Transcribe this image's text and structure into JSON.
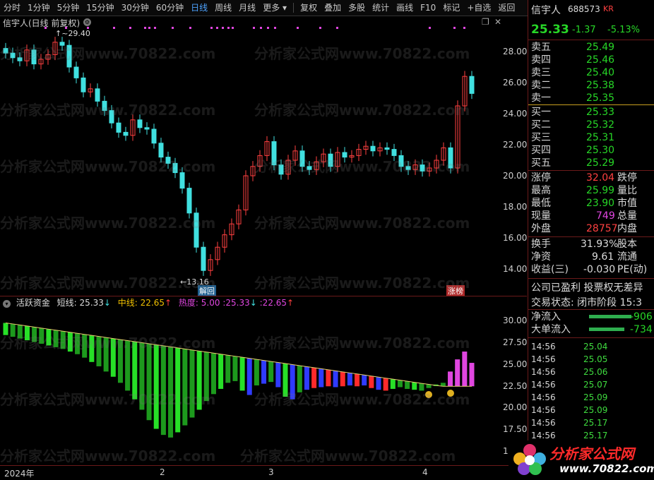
{
  "toolbar": {
    "items": [
      "分时",
      "1分钟",
      "5分钟",
      "15分钟",
      "30分钟",
      "60分钟",
      "日线",
      "周线",
      "月线",
      "更多"
    ],
    "active": "日线",
    "tools": [
      "复权",
      "叠加",
      "多股",
      "统计",
      "画线",
      "F10",
      "标记",
      "+自选",
      "返回"
    ]
  },
  "main_chart": {
    "title": "信宇人(日线 前复权)",
    "high_label": "29.40",
    "low_label": "13.16",
    "badge_left": "解回",
    "badge_right": "涨榜",
    "y_ticks": [
      "28.00",
      "26.00",
      "24.00",
      "22.00",
      "20.00",
      "18.00",
      "16.00",
      "14.00"
    ]
  },
  "indicator": {
    "name": "活跃资金",
    "short_label": "短线:",
    "short_value": "25.33",
    "mid_label": "中线:",
    "mid_value": "22.65",
    "heat_label": "热度:",
    "heat_value": "5.00",
    "extra1": ":25.33",
    "extra2": ":22.65",
    "y_ticks": [
      "30.00",
      "27.50",
      "25.00",
      "22.50",
      "20.00",
      "17.50",
      "15.00"
    ]
  },
  "x_axis": [
    "2024年",
    "2",
    "3",
    "4"
  ],
  "quote": {
    "name": "信宇人",
    "code": "688573",
    "tag": "KR",
    "price": "25.33",
    "change": "-1.37",
    "pct": "-5.13%"
  },
  "order_book": {
    "sells": [
      {
        "label": "卖五",
        "price": "25.49"
      },
      {
        "label": "卖四",
        "price": "25.46"
      },
      {
        "label": "卖三",
        "price": "25.40"
      },
      {
        "label": "卖二",
        "price": "25.38"
      },
      {
        "label": "卖一",
        "price": "25.35"
      }
    ],
    "buys": [
      {
        "label": "买一",
        "price": "25.33"
      },
      {
        "label": "买二",
        "price": "25.32"
      },
      {
        "label": "买三",
        "price": "25.31"
      },
      {
        "label": "买四",
        "price": "25.30"
      },
      {
        "label": "买五",
        "price": "25.29"
      }
    ]
  },
  "stats": {
    "limit_up_label": "涨停",
    "limit_up": "32.04",
    "limit_down_label": "跌停",
    "high_label": "最高",
    "high": "25.99",
    "volratio_label": "量比",
    "low_label": "最低",
    "low": "23.90",
    "mktcap_label": "市值",
    "cur_label": "现量",
    "cur": "749",
    "total_label": "总量",
    "outer_label": "外盘",
    "outer": "28757",
    "inner_label": "内盘",
    "turnover_label": "换手",
    "turnover": "31.93%",
    "equity_label": "股本",
    "netasset_label": "净资",
    "netasset": "9.61",
    "float_label": "流通",
    "eps_label": "收益(三)",
    "eps": "-0.030",
    "pe_label": "PE(动)"
  },
  "info": {
    "line1": "公司已盈利 投票权无差异",
    "line2": "交易状态: 闭市阶段 15:3",
    "netflow_label": "净流入",
    "netflow": "-906",
    "bigflow_label": "大单流入",
    "bigflow": "-734"
  },
  "ticks": [
    {
      "t": "14:56",
      "p": "25.04"
    },
    {
      "t": "14:56",
      "p": "25.05"
    },
    {
      "t": "14:56",
      "p": "25.06"
    },
    {
      "t": "14:56",
      "p": "25.07"
    },
    {
      "t": "14:56",
      "p": "25.09"
    },
    {
      "t": "14:56",
      "p": "25.09"
    },
    {
      "t": "14:56",
      "p": "25.17"
    },
    {
      "t": "14:56",
      "p": "25.17"
    }
  ],
  "watermark": "分析家公式网www.70822.com",
  "logo": {
    "text": "分析家公式网",
    "url": "www.70822.com"
  },
  "colors": {
    "up": "#ff4040",
    "down": "#40e0e0",
    "green": "#27d627",
    "magenta": "#e046e0",
    "blue": "#2f3bff"
  }
}
